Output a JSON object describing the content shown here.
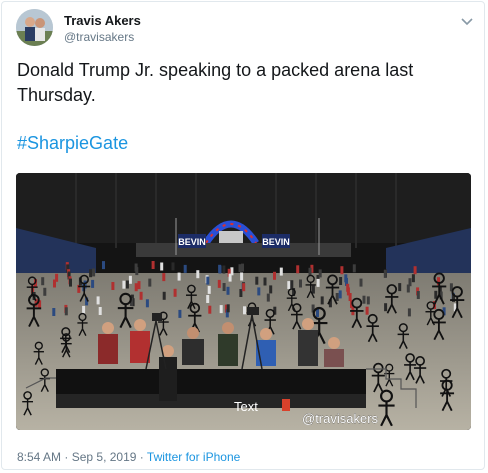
{
  "tweet": {
    "author_name": "Travis Akers",
    "author_handle": "@travisakers",
    "text": "Donald Trump Jr. speaking to a packed arena last Thursday.",
    "hashtag": "#SharpieGate",
    "time": "8:54 AM",
    "date": "Sep 5, 2019",
    "separator": "·",
    "source": "Twitter for iPhone"
  },
  "media": {
    "signs": [
      "BEVIN",
      "BEVIN"
    ],
    "overlay_text": "Text",
    "watermark": "@travisakers"
  },
  "colors": {
    "link": "#1b95e0",
    "secondary": "#657786",
    "border": "#e1e8ed"
  },
  "icons": {
    "menu": "chevron-down-icon",
    "avatar": "avatar"
  }
}
